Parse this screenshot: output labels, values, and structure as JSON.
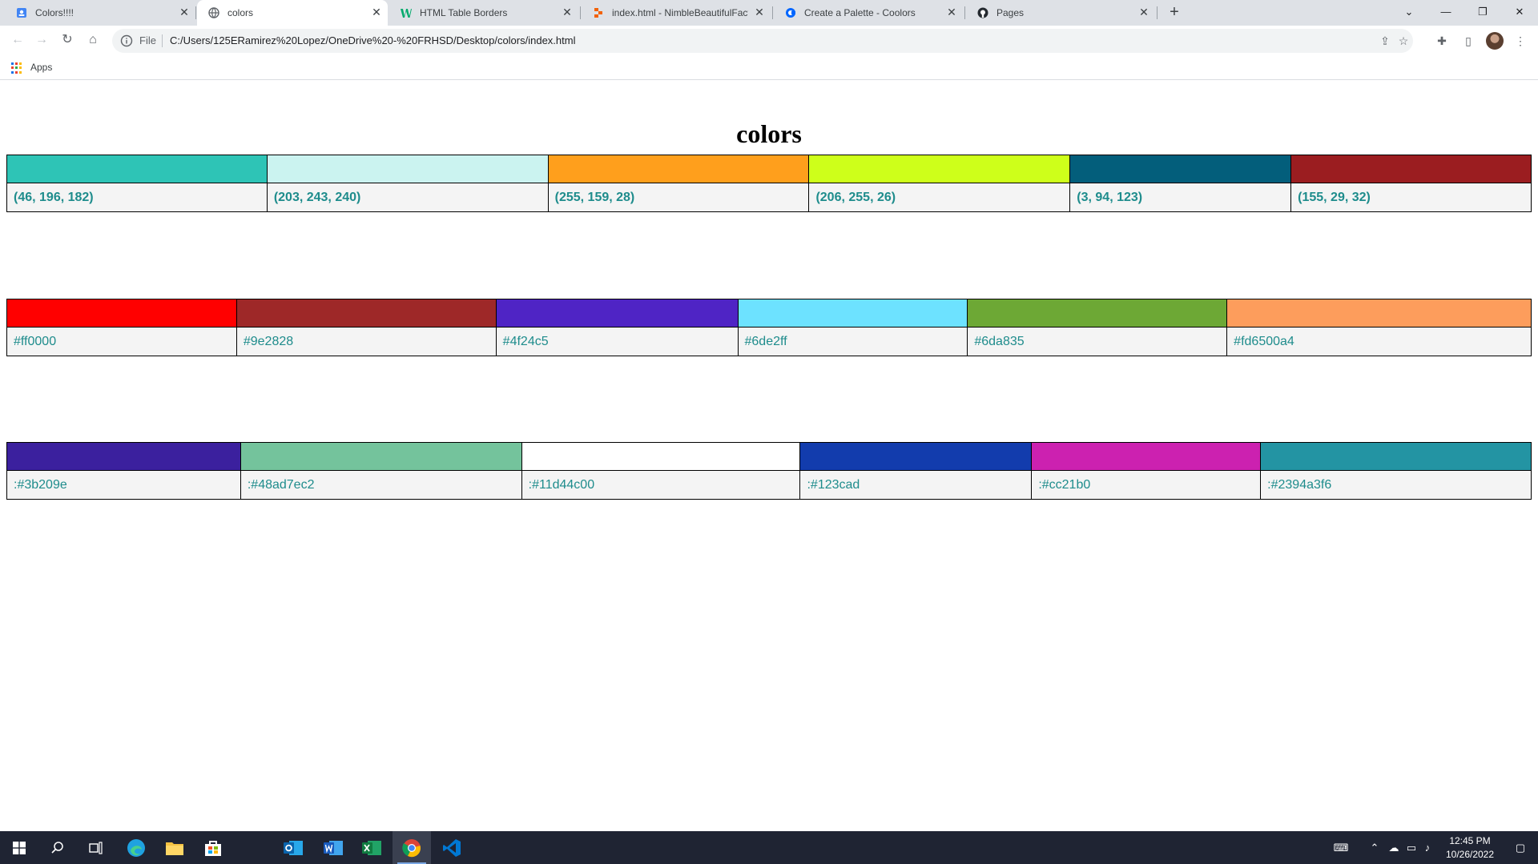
{
  "browser": {
    "tabs": [
      {
        "title": "Colors!!!!",
        "icon": "user-document-icon",
        "active": false
      },
      {
        "title": "colors",
        "icon": "globe-icon",
        "active": true
      },
      {
        "title": "HTML Table Borders",
        "icon": "w3schools-icon",
        "active": false
      },
      {
        "title": "index.html - NimbleBeautifulFact",
        "icon": "replit-icon",
        "active": false
      },
      {
        "title": "Create a Palette - Coolors",
        "icon": "coolors-icon",
        "active": false
      },
      {
        "title": "Pages",
        "icon": "github-icon",
        "active": false
      }
    ],
    "address": {
      "scheme_label": "File",
      "url": "C:/Users/125ERamirez%20Lopez/OneDrive%20-%20FRHSD/Desktop/colors/index.html"
    },
    "bookmarks": {
      "apps_label": "Apps"
    }
  },
  "page": {
    "title": "colors",
    "tables": [
      {
        "kind": "rgb",
        "swatches": [
          {
            "color": "#2ec4b6",
            "label": "(46, 196, 182)"
          },
          {
            "color": "#cbf3f0",
            "label": "(203, 243, 240)"
          },
          {
            "color": "#ff9f1c",
            "label": "(255, 159, 28)"
          },
          {
            "color": "#ceff1a",
            "label": "(206, 255, 26)"
          },
          {
            "color": "#035e7b",
            "label": "(3, 94, 123)"
          },
          {
            "color": "#9b1d20",
            "label": "(155, 29, 32)"
          }
        ]
      },
      {
        "kind": "hex",
        "swatches": [
          {
            "color": "#ff0000",
            "label": "#ff0000"
          },
          {
            "color": "#9e2828",
            "label": "#9e2828"
          },
          {
            "color": "#4f24c5",
            "label": "#4f24c5"
          },
          {
            "color": "#6de2ff",
            "label": "#6de2ff"
          },
          {
            "color": "#6da835",
            "label": "#6da835"
          },
          {
            "color": "#fd9d5c",
            "label": "#fd6500a4"
          }
        ]
      },
      {
        "kind": "hex",
        "swatches": [
          {
            "color": "#3b209e",
            "label": ":#3b209e"
          },
          {
            "color": "#74c39c",
            "label": ":#48ad7ec2"
          },
          {
            "color": "#ffffff",
            "label": ":#11d44c00"
          },
          {
            "color": "#123cad",
            "label": ":#123cad"
          },
          {
            "color": "#cc21b0",
            "label": ":#cc21b0"
          },
          {
            "color": "#2394a3",
            "label": ":#2394a3f6"
          }
        ]
      }
    ]
  },
  "taskbar": {
    "apps": [
      "windows-start-icon",
      "search-icon",
      "task-view-icon",
      "edge-icon",
      "file-explorer-icon",
      "store-icon",
      "outlook-icon",
      "word-icon",
      "excel-icon",
      "chrome-icon",
      "vscode-icon"
    ],
    "clock": {
      "time": "12:45 PM",
      "date": "10/26/2022"
    }
  },
  "colors": {
    "tabstrip_bg": "#dee1e6",
    "code_text": "#1e8c8c",
    "taskbar_bg": "#1f2433"
  }
}
